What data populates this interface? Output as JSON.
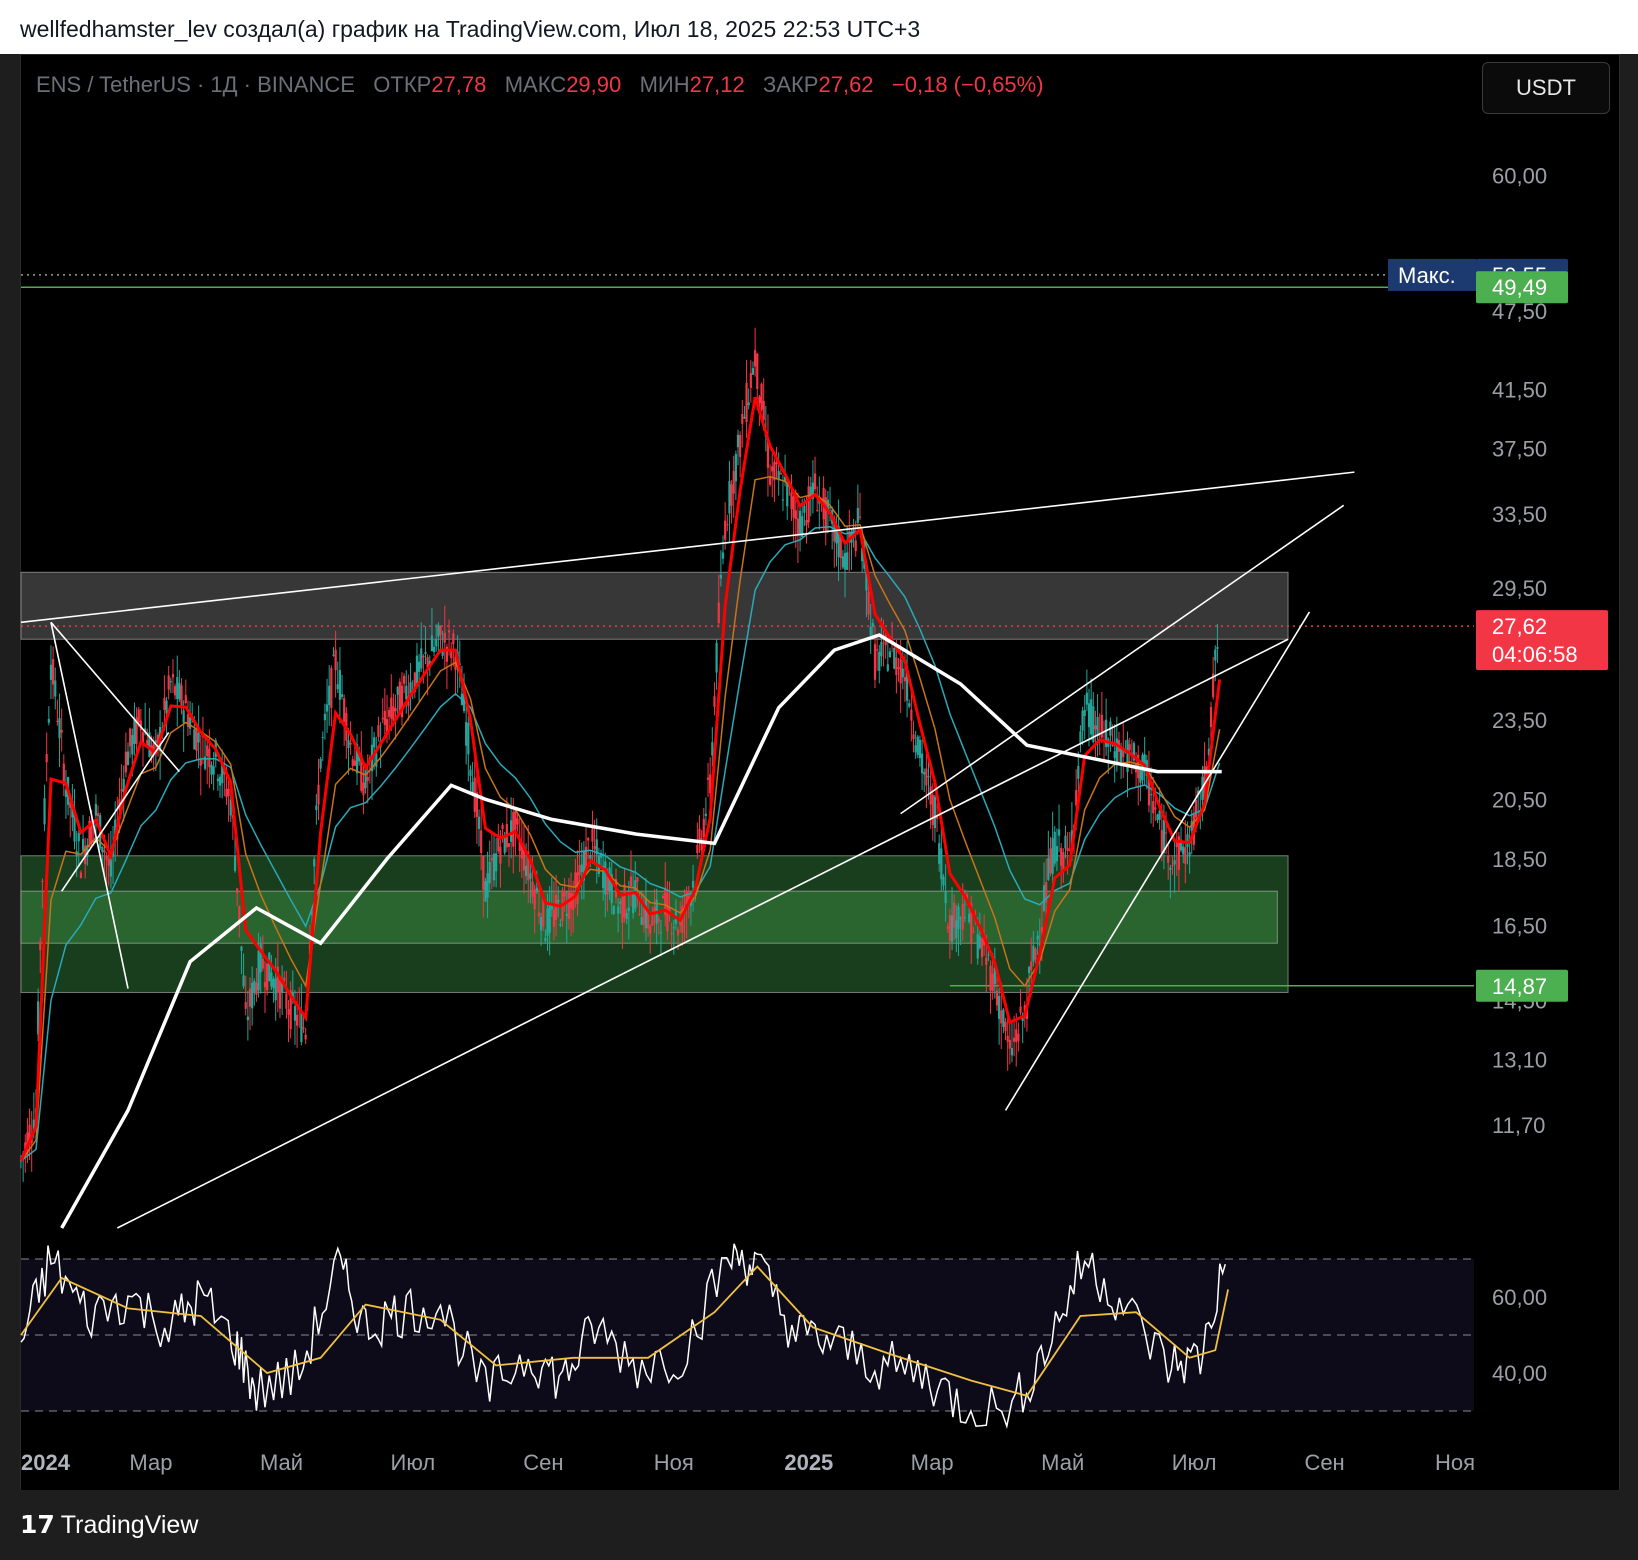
{
  "header": {
    "text": "wellfedhamster_lev создал(а) график на TradingView.com, Июл 18, 2025 22:53 UTC+3"
  },
  "legend": {
    "symbol": "ENS / TetherUS · 1Д · BINANCE",
    "open_label": "ОТКР",
    "open": "27,78",
    "high_label": "МАКС",
    "high": "29,90",
    "low_label": "МИН",
    "low": "27,12",
    "close_label": "ЗАКР",
    "close": "27,62",
    "change": "−0,18 (−0,65%)"
  },
  "currency_button": "USDT",
  "footer": {
    "brand": "TradingView",
    "brand_mark": "17"
  },
  "colors": {
    "background": "#000000",
    "up": "#26a69a",
    "down": "#f23645",
    "ema_fast": "#ff0000",
    "ema_mid": "#c8741a",
    "ema_teal": "#2aa9b8",
    "ema_slow": "#ffffff",
    "zone_green": "#1f4d24",
    "zone_green_inner": "#2e6b33",
    "zone_grey": "#4a4a4a",
    "rsi": "#ffffff",
    "rsi_ma": "#f0c040"
  },
  "chart_data": {
    "type": "candlestick",
    "price_axis": {
      "scale": "log",
      "ticks": [
        "60,00",
        "47,50",
        "41,50",
        "37,50",
        "33,50",
        "29,50",
        "23,50",
        "20,50",
        "18,50",
        "16,50",
        "14,50",
        "13,10",
        "11,70"
      ],
      "tick_values": [
        60,
        47.5,
        41.5,
        37.5,
        33.5,
        29.5,
        23.5,
        20.5,
        18.5,
        16.5,
        14.5,
        13.1,
        11.7
      ],
      "range": [
        9.6,
        66
      ]
    },
    "time_axis": {
      "labels": [
        "2024",
        "Мар",
        "Май",
        "Июл",
        "Сен",
        "Ноя",
        "2025",
        "Мар",
        "Май",
        "Июл",
        "Сен",
        "Ноя"
      ],
      "bold_labels": [
        "2024",
        "2025"
      ]
    },
    "price_labels": [
      {
        "label": "Макс.",
        "value": "50,55",
        "price": 50.55,
        "bg": "#1c3a70"
      },
      {
        "value": "49,49",
        "price": 49.49,
        "bg": "#4caf50"
      },
      {
        "value": "27,62",
        "countdown": "04:06:58",
        "price": 27.62,
        "bg": "#f23645"
      },
      {
        "value": "14,87",
        "price": 14.87,
        "bg": "#4caf50"
      }
    ],
    "zones": [
      {
        "name": "resistance-zone",
        "from": 27.0,
        "to": 30.3,
        "t0": "2024-01-01",
        "t1": "2025-08-15"
      },
      {
        "name": "support-zone-outer",
        "from": 14.7,
        "to": 18.6,
        "t0": "2024-01-01",
        "t1": "2025-08-15"
      },
      {
        "name": "support-zone-inner",
        "from": 16.0,
        "to": 17.5,
        "t0": "2024-01-01",
        "t1": "2025-08-10"
      }
    ],
    "horizontal_lines": [
      {
        "price": 50.55,
        "style": "dotted",
        "color": "#9aa0a6"
      },
      {
        "price": 49.49,
        "style": "solid",
        "color": "#4caf50"
      },
      {
        "price": 27.62,
        "style": "dotted",
        "color": "#f23645"
      },
      {
        "price": 14.87,
        "style": "solid",
        "color": "#4caf50",
        "t0": "2025-03-10"
      }
    ],
    "trendlines": [
      {
        "t0": "2024-01-01",
        "p0": 27.8,
        "t1": "2025-09-15",
        "p1": 36.0
      },
      {
        "t0": "2024-02-15",
        "p0": 9.8,
        "t1": "2025-08-15",
        "p1": 27.0
      },
      {
        "t0": "2025-02-15",
        "p0": 20.0,
        "t1": "2025-09-10",
        "p1": 34.0
      },
      {
        "t0": "2025-04-05",
        "p0": 12.0,
        "t1": "2025-08-25",
        "p1": 28.3
      },
      {
        "t0": "2024-01-15",
        "p0": 27.8,
        "t1": "2024-03-15",
        "p1": 21.5
      },
      {
        "t0": "2024-01-15",
        "p0": 27.8,
        "t1": "2024-02-20",
        "p1": 14.8
      },
      {
        "t0": "2024-01-20",
        "p0": 17.5,
        "t1": "2024-03-10",
        "p1": 23.0
      }
    ],
    "price_series": [
      [
        "2024-01-01",
        11
      ],
      [
        "2024-01-08",
        12
      ],
      [
        "2024-01-15",
        26
      ],
      [
        "2024-01-22",
        21
      ],
      [
        "2024-01-29",
        18.5
      ],
      [
        "2024-02-05",
        20
      ],
      [
        "2024-02-12",
        18
      ],
      [
        "2024-02-19",
        22
      ],
      [
        "2024-02-26",
        23.5
      ],
      [
        "2024-03-04",
        22
      ],
      [
        "2024-03-11",
        25
      ],
      [
        "2024-03-18",
        24
      ],
      [
        "2024-03-25",
        22.5
      ],
      [
        "2024-04-01",
        22
      ],
      [
        "2024-04-08",
        20.5
      ],
      [
        "2024-04-15",
        14
      ],
      [
        "2024-04-22",
        15.5
      ],
      [
        "2024-04-29",
        15
      ],
      [
        "2024-05-06",
        14.3
      ],
      [
        "2024-05-13",
        13.8
      ],
      [
        "2024-05-20",
        22
      ],
      [
        "2024-05-27",
        26
      ],
      [
        "2024-06-03",
        22.5
      ],
      [
        "2024-06-10",
        21
      ],
      [
        "2024-06-17",
        23
      ],
      [
        "2024-06-24",
        24
      ],
      [
        "2024-07-01",
        25
      ],
      [
        "2024-07-08",
        26
      ],
      [
        "2024-07-15",
        27
      ],
      [
        "2024-07-22",
        26.5
      ],
      [
        "2024-07-29",
        22
      ],
      [
        "2024-08-05",
        17.5
      ],
      [
        "2024-08-12",
        19
      ],
      [
        "2024-08-19",
        19.5
      ],
      [
        "2024-08-26",
        18
      ],
      [
        "2024-09-02",
        16.5
      ],
      [
        "2024-09-09",
        17
      ],
      [
        "2024-09-16",
        17.5
      ],
      [
        "2024-09-23",
        19
      ],
      [
        "2024-09-30",
        18
      ],
      [
        "2024-10-07",
        17
      ],
      [
        "2024-10-14",
        17.5
      ],
      [
        "2024-10-21",
        16.5
      ],
      [
        "2024-10-28",
        17
      ],
      [
        "2024-11-04",
        16.5
      ],
      [
        "2024-11-11",
        18
      ],
      [
        "2024-11-18",
        21
      ],
      [
        "2024-11-25",
        33
      ],
      [
        "2024-12-02",
        38
      ],
      [
        "2024-12-09",
        44
      ],
      [
        "2024-12-16",
        36
      ],
      [
        "2024-12-23",
        35
      ],
      [
        "2024-12-30",
        33
      ],
      [
        "2025-01-06",
        35
      ],
      [
        "2025-01-13",
        33
      ],
      [
        "2025-01-20",
        31
      ],
      [
        "2025-01-27",
        33
      ],
      [
        "2025-02-03",
        26
      ],
      [
        "2025-02-10",
        26.5
      ],
      [
        "2025-02-17",
        25.5
      ],
      [
        "2025-02-24",
        22
      ],
      [
        "2025-03-03",
        20
      ],
      [
        "2025-03-10",
        16.5
      ],
      [
        "2025-03-17",
        17
      ],
      [
        "2025-03-24",
        16
      ],
      [
        "2025-03-31",
        15
      ],
      [
        "2025-04-07",
        13.2
      ],
      [
        "2025-04-14",
        14.2
      ],
      [
        "2025-04-21",
        16.5
      ],
      [
        "2025-04-28",
        19
      ],
      [
        "2025-05-05",
        18.5
      ],
      [
        "2025-05-12",
        24
      ],
      [
        "2025-05-19",
        23
      ],
      [
        "2025-05-26",
        22.5
      ],
      [
        "2025-06-02",
        22
      ],
      [
        "2025-06-09",
        21.5
      ],
      [
        "2025-06-16",
        19.5
      ],
      [
        "2025-06-23",
        18.5
      ],
      [
        "2025-06-30",
        19
      ],
      [
        "2025-07-07",
        21
      ],
      [
        "2025-07-14",
        27.62
      ]
    ],
    "ema_slow_series": [
      [
        "2024-01-20",
        9.8
      ],
      [
        "2024-02-20",
        12
      ],
      [
        "2024-03-20",
        15.5
      ],
      [
        "2024-04-20",
        17
      ],
      [
        "2024-05-20",
        16
      ],
      [
        "2024-06-20",
        18.5
      ],
      [
        "2024-07-20",
        21
      ],
      [
        "2024-08-05",
        20.5
      ],
      [
        "2024-09-05",
        19.8
      ],
      [
        "2024-10-15",
        19.3
      ],
      [
        "2024-11-20",
        19
      ],
      [
        "2024-12-20",
        24
      ],
      [
        "2025-01-15",
        26.5
      ],
      [
        "2025-02-05",
        27.2
      ],
      [
        "2025-03-15",
        25
      ],
      [
        "2025-04-15",
        22.5
      ],
      [
        "2025-05-15",
        22
      ],
      [
        "2025-06-15",
        21.5
      ],
      [
        "2025-07-15",
        21.5
      ]
    ],
    "rsi": {
      "levels": [
        70,
        50,
        30
      ],
      "ticks": [
        "60,00",
        "40,00"
      ],
      "tick_values": [
        60,
        40
      ],
      "range": [
        25,
        75
      ],
      "series": [
        [
          "2024-01-01",
          48
        ],
        [
          "2024-01-15",
          70
        ],
        [
          "2024-02-01",
          55
        ],
        [
          "2024-02-20",
          60
        ],
        [
          "2024-03-10",
          52
        ],
        [
          "2024-03-25",
          60
        ],
        [
          "2024-04-10",
          48
        ],
        [
          "2024-04-20",
          35
        ],
        [
          "2024-05-10",
          40
        ],
        [
          "2024-05-28",
          68
        ],
        [
          "2024-06-10",
          52
        ],
        [
          "2024-06-25",
          56
        ],
        [
          "2024-07-15",
          58
        ],
        [
          "2024-08-05",
          35
        ],
        [
          "2024-08-25",
          45
        ],
        [
          "2024-09-10",
          38
        ],
        [
          "2024-09-25",
          52
        ],
        [
          "2024-10-15",
          42
        ],
        [
          "2024-11-05",
          45
        ],
        [
          "2024-11-28",
          72
        ],
        [
          "2024-12-10",
          68
        ],
        [
          "2024-12-28",
          50
        ],
        [
          "2025-01-15",
          48
        ],
        [
          "2025-02-05",
          42
        ],
        [
          "2025-02-25",
          40
        ],
        [
          "2025-03-15",
          32
        ],
        [
          "2025-04-08",
          30
        ],
        [
          "2025-04-25",
          48
        ],
        [
          "2025-05-12",
          70
        ],
        [
          "2025-05-30",
          58
        ],
        [
          "2025-06-20",
          42
        ],
        [
          "2025-07-05",
          44
        ],
        [
          "2025-07-18",
          72
        ]
      ],
      "ma_series": [
        [
          "2024-01-01",
          50
        ],
        [
          "2024-01-20",
          65
        ],
        [
          "2024-02-20",
          57
        ],
        [
          "2024-03-25",
          55
        ],
        [
          "2024-04-25",
          40
        ],
        [
          "2024-05-20",
          44
        ],
        [
          "2024-06-10",
          58
        ],
        [
          "2024-07-15",
          54
        ],
        [
          "2024-08-10",
          42
        ],
        [
          "2024-09-15",
          44
        ],
        [
          "2024-10-20",
          44
        ],
        [
          "2024-11-20",
          56
        ],
        [
          "2024-12-10",
          68
        ],
        [
          "2025-01-05",
          52
        ],
        [
          "2025-02-10",
          45
        ],
        [
          "2025-03-20",
          38
        ],
        [
          "2025-04-15",
          34
        ],
        [
          "2025-05-10",
          55
        ],
        [
          "2025-06-05",
          56
        ],
        [
          "2025-06-30",
          44
        ],
        [
          "2025-07-12",
          46
        ],
        [
          "2025-07-18",
          62
        ]
      ]
    }
  }
}
